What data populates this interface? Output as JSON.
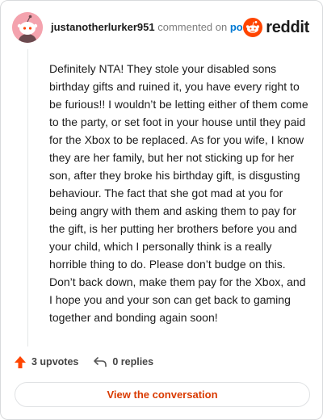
{
  "comment": {
    "author": "justanotherlurker951",
    "commented_on": "commented on",
    "post_link": "post",
    "body": "Definitely NTA! They stole your disabled sons birthday gifts and ruined it, you have every right to be furious!! I wouldn’t be letting either of them come to the party, or set foot in your house until they paid for the Xbox to be replaced. As for you wife, I know they are her family, but her not sticking up for her son, after they broke his birthday gift, is disgusting behaviour. The fact that she got mad at you for being angry with them and asking them to pay for the gift, is her putting her brothers before you and your child, which I personally think is a really horrible thing to do. Please don’t budge on this. Don’t back down, make them pay for the Xbox, and I hope you and your son can get back to gaming together and bonding again soon!"
  },
  "brand": {
    "name": "reddit",
    "color": "#ff4500",
    "icon": "reddit-snoo-icon"
  },
  "actions": {
    "upvotes_label": "3 upvotes",
    "upvote_icon": "upvote-arrow-icon",
    "upvote_color": "#ff4500",
    "replies_label": "0 replies",
    "reply_icon": "reply-arrow-icon"
  },
  "view_button": {
    "label": "View the conversation",
    "color": "#d93a00"
  }
}
